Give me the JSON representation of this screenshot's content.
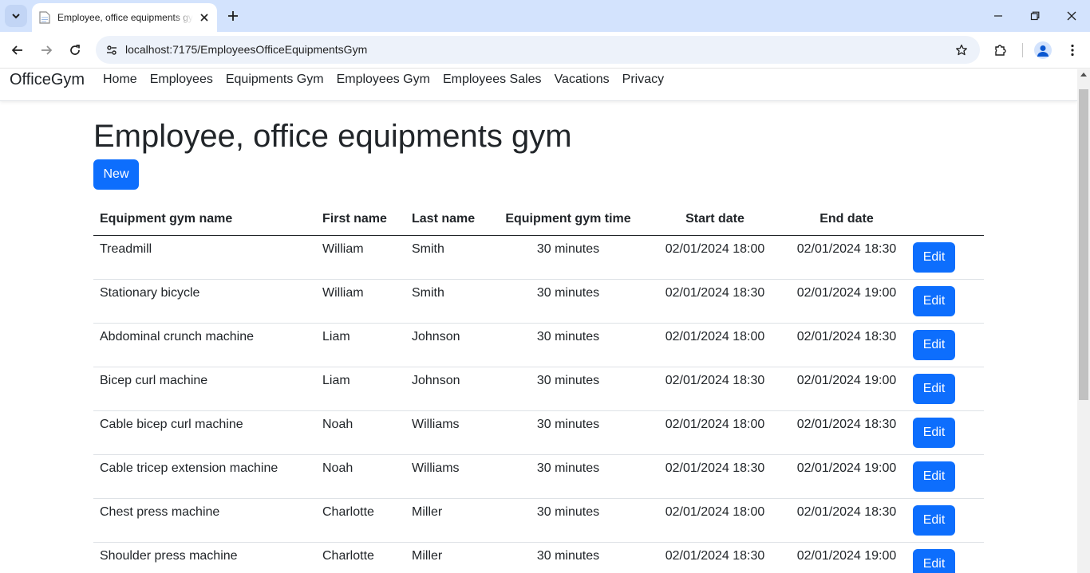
{
  "browser": {
    "tab_title": "Employee, office equipments gym",
    "url": "localhost:7175/EmployeesOfficeEquipmentsGym"
  },
  "navbar": {
    "brand": "OfficeGym",
    "links": [
      "Home",
      "Employees",
      "Equipments Gym",
      "Employees Gym",
      "Employees Sales",
      "Vacations",
      "Privacy"
    ]
  },
  "main": {
    "title": "Employee, office equipments gym",
    "new_label": "New",
    "columns": [
      "Equipment gym name",
      "First name",
      "Last name",
      "Equipment gym time",
      "Start date",
      "End date"
    ],
    "edit_label": "Edit",
    "rows": [
      {
        "equipment": "Treadmill",
        "first": "William",
        "last": "Smith",
        "time": "30 minutes",
        "start": "02/01/2024 18:00",
        "end": "02/01/2024 18:30"
      },
      {
        "equipment": "Stationary bicycle",
        "first": "William",
        "last": "Smith",
        "time": "30 minutes",
        "start": "02/01/2024 18:30",
        "end": "02/01/2024 19:00"
      },
      {
        "equipment": "Abdominal crunch machine",
        "first": "Liam",
        "last": "Johnson",
        "time": "30 minutes",
        "start": "02/01/2024 18:00",
        "end": "02/01/2024 18:30"
      },
      {
        "equipment": "Bicep curl machine",
        "first": "Liam",
        "last": "Johnson",
        "time": "30 minutes",
        "start": "02/01/2024 18:30",
        "end": "02/01/2024 19:00"
      },
      {
        "equipment": "Cable bicep curl machine",
        "first": "Noah",
        "last": "Williams",
        "time": "30 minutes",
        "start": "02/01/2024 18:00",
        "end": "02/01/2024 18:30"
      },
      {
        "equipment": "Cable tricep extension machine",
        "first": "Noah",
        "last": "Williams",
        "time": "30 minutes",
        "start": "02/01/2024 18:30",
        "end": "02/01/2024 19:00"
      },
      {
        "equipment": "Chest press machine",
        "first": "Charlotte",
        "last": "Miller",
        "time": "30 minutes",
        "start": "02/01/2024 18:00",
        "end": "02/01/2024 18:30"
      },
      {
        "equipment": "Shoulder press machine",
        "first": "Charlotte",
        "last": "Miller",
        "time": "30 minutes",
        "start": "02/01/2024 18:30",
        "end": "02/01/2024 19:00"
      }
    ]
  },
  "colors": {
    "primary": "#0d6efd",
    "tabstrip": "#d3e3fd",
    "omnibox": "#edf2fa"
  }
}
